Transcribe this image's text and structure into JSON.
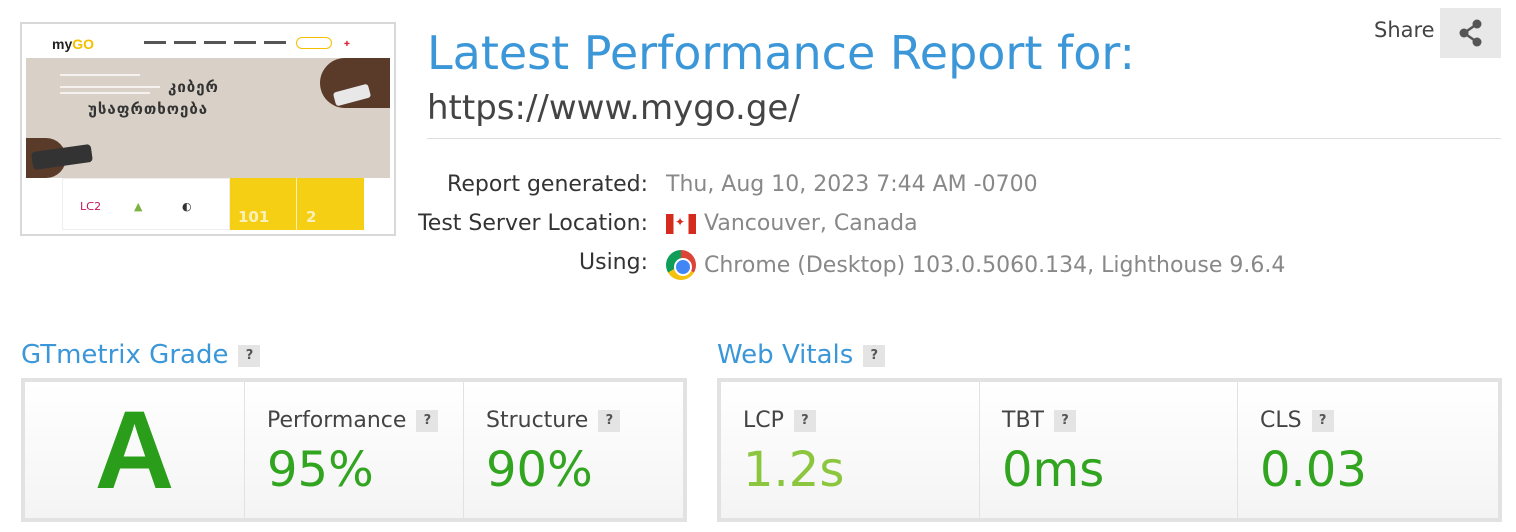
{
  "header": {
    "title": "Latest Performance Report for:",
    "url": "https://www.mygo.ge/",
    "share_label": "Share"
  },
  "thumbnail": {
    "logo_my": "my",
    "logo_go": "GO",
    "headline_line1": "კიბერ",
    "headline_line2": "უსაფრთხოება",
    "stat_1": "101",
    "stat_2": "2"
  },
  "meta": {
    "report_generated_label": "Report generated:",
    "report_generated_value": "Thu, Aug 10, 2023 7:44 AM -0700",
    "location_label": "Test Server Location:",
    "location_value": "Vancouver, Canada",
    "using_label": "Using:",
    "using_value": "Chrome (Desktop) 103.0.5060.134, Lighthouse 9.6.4"
  },
  "grade_section": {
    "title": "GTmetrix Grade",
    "help": "?",
    "grade": "A",
    "performance_label": "Performance",
    "performance_value": "95%",
    "structure_label": "Structure",
    "structure_value": "90%"
  },
  "vitals_section": {
    "title": "Web Vitals",
    "help": "?",
    "lcp_label": "LCP",
    "lcp_value": "1.2s",
    "tbt_label": "TBT",
    "tbt_value": "0ms",
    "cls_label": "CLS",
    "cls_value": "0.03"
  },
  "colors": {
    "accent_blue": "#3b97d8",
    "green": "#31a51f",
    "light_green": "#8cc63f"
  },
  "icons": {
    "share": "share-icon",
    "flag": "canada-flag-icon",
    "browser": "chrome-icon",
    "help": "help-icon"
  }
}
